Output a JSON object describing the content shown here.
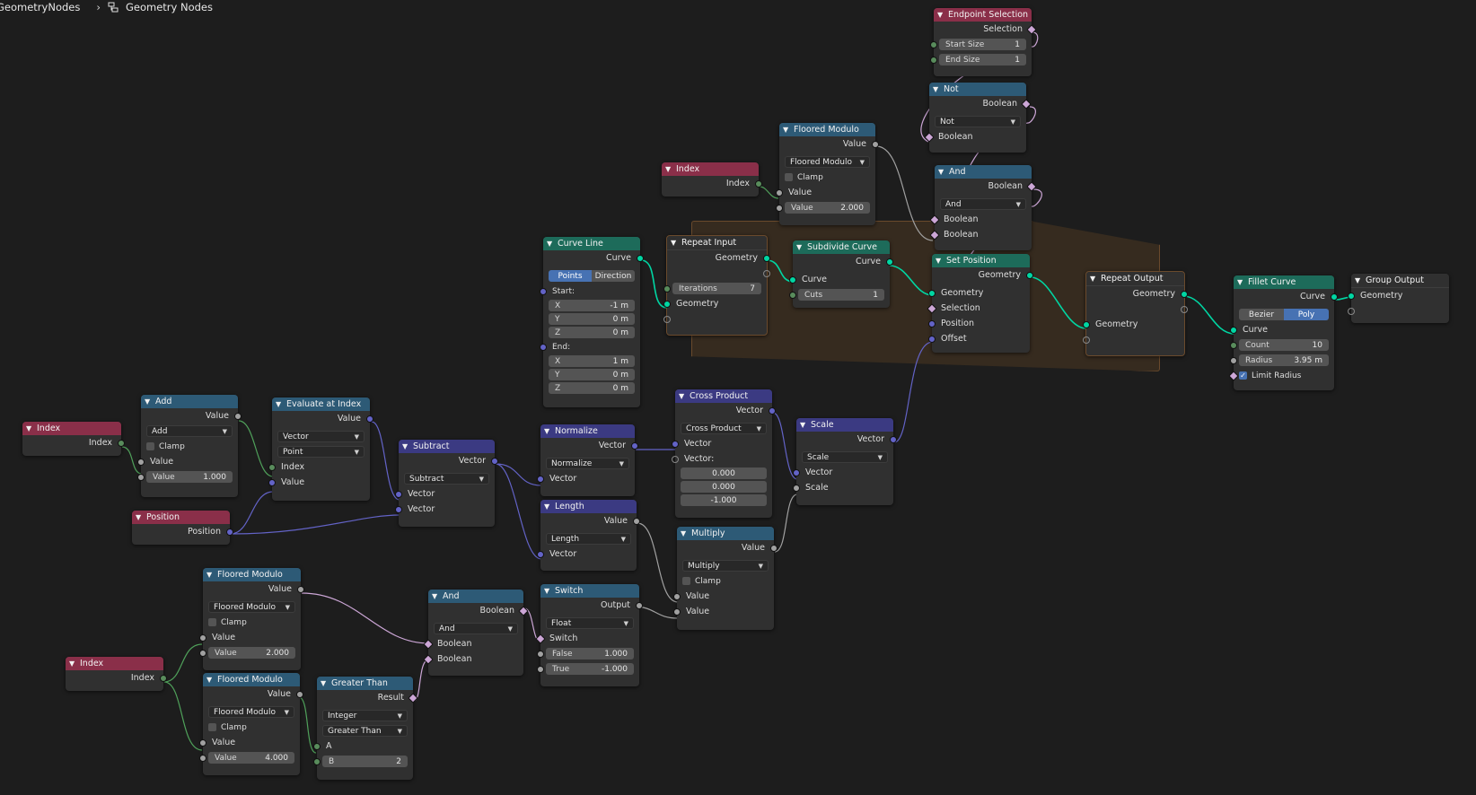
{
  "breadcrumb": {
    "tree": "GeometryNodes",
    "current": "Geometry Nodes"
  },
  "colors": {
    "input": "#8a2f49",
    "math": "#2d5a76",
    "vector": "#3b3a82",
    "geometry": "#1d6b5a",
    "frame": "#362b1f",
    "geometry_socket": "#00d6a3"
  },
  "nodes": {
    "index1": {
      "title": "Index",
      "out": "Index"
    },
    "add": {
      "title": "Add",
      "out": "Value",
      "op": "Add",
      "clamp": "Clamp",
      "in1": "Value",
      "val_label": "Value",
      "val": "1.000"
    },
    "eval": {
      "title": "Evaluate at Index",
      "out": "Value",
      "type": "Vector",
      "domain": "Point",
      "in1": "Index",
      "in2": "Value"
    },
    "position": {
      "title": "Position",
      "out": "Position"
    },
    "subtract": {
      "title": "Subtract",
      "out": "Vector",
      "op": "Subtract",
      "in1": "Vector",
      "in2": "Vector"
    },
    "normalize": {
      "title": "Normalize",
      "out": "Vector",
      "op": "Normalize",
      "in1": "Vector"
    },
    "length": {
      "title": "Length",
      "out": "Value",
      "op": "Length",
      "in1": "Vector"
    },
    "cross": {
      "title": "Cross Product",
      "out": "Vector",
      "op": "Cross Product",
      "in1": "Vector",
      "in2": "Vector:",
      "v1": "0.000",
      "v2": "0.000",
      "v3": "-1.000"
    },
    "multiply": {
      "title": "Multiply",
      "out": "Value",
      "op": "Multiply",
      "clamp": "Clamp",
      "in1": "Value",
      "in2": "Value"
    },
    "scale": {
      "title": "Scale",
      "out": "Vector",
      "op": "Scale",
      "in1": "Vector",
      "in2": "Scale"
    },
    "curveline": {
      "title": "Curve Line",
      "out": "Curve",
      "mode1": "Points",
      "mode2": "Direction",
      "start": "Start:",
      "end": "End:",
      "sx": "X",
      "sxv": "-1 m",
      "sy": "Y",
      "syv": "0 m",
      "sz": "Z",
      "szv": "0 m",
      "ex": "X",
      "exv": "1 m",
      "ey": "Y",
      "eyv": "0 m",
      "ez": "Z",
      "ezv": "0 m"
    },
    "repeatin": {
      "title": "Repeat Input",
      "out": "Geometry",
      "iter_label": "Iterations",
      "iter": "7",
      "in1": "Geometry"
    },
    "subdivide": {
      "title": "Subdivide Curve",
      "out": "Curve",
      "in1": "Curve",
      "cuts_label": "Cuts",
      "cuts": "1"
    },
    "index2": {
      "title": "Index",
      "out": "Index"
    },
    "fmod1": {
      "title": "Floored Modulo",
      "out": "Value",
      "op": "Floored Modulo",
      "clamp": "Clamp",
      "in1": "Value",
      "val_label": "Value",
      "val": "2.000"
    },
    "endsel": {
      "title": "Endpoint Selection",
      "out": "Selection",
      "s_label": "Start Size",
      "s": "1",
      "e_label": "End Size",
      "e": "1"
    },
    "not": {
      "title": "Not",
      "out": "Boolean",
      "op": "Not",
      "in1": "Boolean"
    },
    "and1": {
      "title": "And",
      "out": "Boolean",
      "op": "And",
      "in1": "Boolean",
      "in2": "Boolean"
    },
    "setpos": {
      "title": "Set Position",
      "out": "Geometry",
      "in1": "Geometry",
      "in2": "Selection",
      "in3": "Position",
      "in4": "Offset"
    },
    "repeatout": {
      "title": "Repeat Output",
      "out": "Geometry",
      "in1": "Geometry"
    },
    "fillet": {
      "title": "Fillet Curve",
      "out": "Curve",
      "mode1": "Bezier",
      "mode2": "Poly",
      "in1": "Curve",
      "count_label": "Count",
      "count": "10",
      "radius_label": "Radius",
      "radius": "3.95 m",
      "limit": "Limit Radius"
    },
    "groupout": {
      "title": "Group Output",
      "in1": "Geometry"
    },
    "index3": {
      "title": "Index",
      "out": "Index"
    },
    "fmod2": {
      "title": "Floored Modulo",
      "out": "Value",
      "op": "Floored Modulo",
      "clamp": "Clamp",
      "in1": "Value",
      "val_label": "Value",
      "val": "2.000"
    },
    "fmod3": {
      "title": "Floored Modulo",
      "out": "Value",
      "op": "Floored Modulo",
      "clamp": "Clamp",
      "in1": "Value",
      "val_label": "Value",
      "val": "4.000"
    },
    "greater": {
      "title": "Greater Than",
      "out": "Result",
      "type": "Integer",
      "op": "Greater Than",
      "in1": "A",
      "b_label": "B",
      "b": "2"
    },
    "and2": {
      "title": "And",
      "out": "Boolean",
      "op": "And",
      "in1": "Boolean",
      "in2": "Boolean"
    },
    "switch": {
      "title": "Switch",
      "out": "Output",
      "type": "Float",
      "in1": "Switch",
      "f_label": "False",
      "f": "1.000",
      "t_label": "True",
      "t": "-1.000"
    }
  }
}
